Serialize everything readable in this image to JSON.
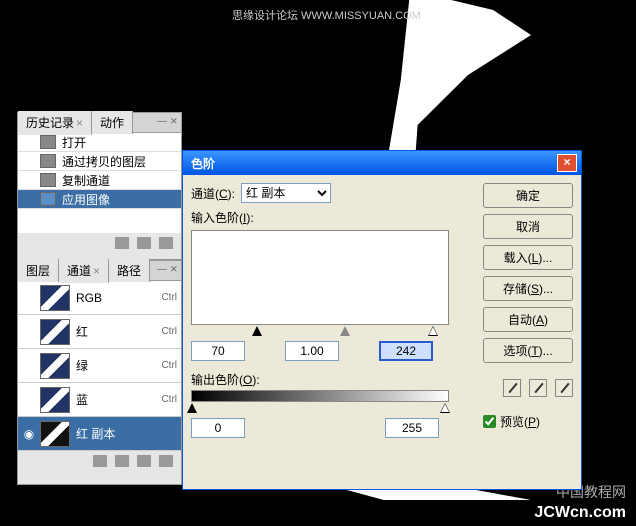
{
  "watermarks": {
    "top": "思缘设计论坛 WWW.MISSYUAN.COM",
    "cn": "中国教程网",
    "bottom": "JCWcn.com"
  },
  "history": {
    "tabs": [
      {
        "label": "历史记录",
        "close": "×"
      },
      {
        "label": "动作"
      }
    ],
    "items": [
      {
        "label": "打开"
      },
      {
        "label": "通过拷贝的图层"
      },
      {
        "label": "复制通道"
      },
      {
        "label": "应用图像",
        "selected": true
      }
    ]
  },
  "channels": {
    "tabs": [
      {
        "label": "图层"
      },
      {
        "label": "通道",
        "close": "×"
      },
      {
        "label": "路径"
      }
    ],
    "items": [
      {
        "label": "RGB",
        "shortcut": "Ctrl"
      },
      {
        "label": "红",
        "shortcut": "Ctrl"
      },
      {
        "label": "绿",
        "shortcut": "Ctrl"
      },
      {
        "label": "蓝",
        "shortcut": "Ctrl"
      },
      {
        "label": "红 副本",
        "selected": true,
        "eye": "◉"
      }
    ]
  },
  "levels": {
    "title": "色阶",
    "channel_label": "通道(",
    "channel_key": "C",
    "channel_label2": "):",
    "channel_value": "红 副本",
    "input_label": "输入色阶(",
    "input_key": "I",
    "input_label2": "):",
    "input": {
      "black": "70",
      "gamma": "1.00",
      "white": "242"
    },
    "output_label": "输出色阶(",
    "output_key": "O",
    "output_label2": "):",
    "output": {
      "black": "0",
      "white": "255"
    },
    "buttons": {
      "ok": "确定",
      "cancel": "取消",
      "load": "载入(",
      "load_key": "L",
      "load2": ")...",
      "save": "存储(",
      "save_key": "S",
      "save2": ")...",
      "auto": "自动(",
      "auto_key": "A",
      "auto2": ")",
      "opt": "选项(",
      "opt_key": "T",
      "opt2": ")..."
    },
    "preview": "预览(",
    "preview_key": "P",
    "preview2": ")"
  }
}
